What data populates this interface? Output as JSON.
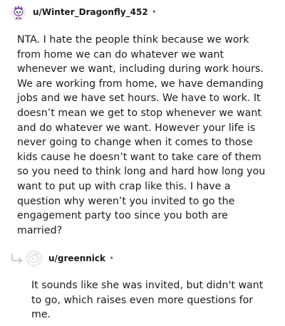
{
  "comments": [
    {
      "username": "u/Winter_Dragonfly_452",
      "separator": "•",
      "avatar_icon": "snoo-avatar-purple-icon",
      "body": "NTA. I hate the people think because we work from home we can do whatever we want whenever we want, including during work hours. We are working from home, we have demanding jobs and we have set hours. We have to work. It doesn’t mean we get to stop whenever we want and do whatever we want. However your life is never going to change when it comes to those kids cause he doesn’t want to take care of them so you need to think long and hard how long you want to put up with crap like this. I have a question why weren’t you invited to go the engagement party too since you both are married?"
    },
    {
      "username": "u/greennick",
      "separator": "•",
      "avatar_icon": "default-avatar-icon",
      "reply_icon": "reply-arrow-icon",
      "body": "It sounds like she was invited, but didn't want to go, which raises even more questions for me."
    }
  ],
  "colors": {
    "text": "#1c1c1c",
    "muted": "#7c7c7c",
    "avatar_purple": "#9b59b6",
    "reply_arrow": "#c8c8c8"
  }
}
